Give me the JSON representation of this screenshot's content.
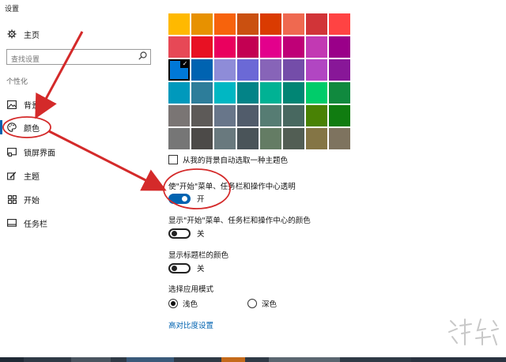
{
  "window": {
    "title": "设置"
  },
  "nav": {
    "home": {
      "label": "主页",
      "icon": "gear-icon"
    },
    "search": {
      "placeholder": "查找设置",
      "icon": "search-icon"
    },
    "section": "个性化",
    "items": [
      {
        "label": "背景",
        "icon": "image-icon"
      },
      {
        "label": "颜色",
        "icon": "palette-icon",
        "active": true
      },
      {
        "label": "锁屏界面",
        "icon": "lock-screen-icon"
      },
      {
        "label": "主题",
        "icon": "theme-icon"
      },
      {
        "label": "开始",
        "icon": "start-grid-icon"
      },
      {
        "label": "任务栏",
        "icon": "taskbar-icon"
      }
    ]
  },
  "colors": {
    "accent": "#0063b1",
    "swatches": [
      "#ffb900",
      "#e79100",
      "#f7630c",
      "#ca5010",
      "#da3b01",
      "#ef6950",
      "#d13438",
      "#ff4343",
      "#e74856",
      "#e81123",
      "#ea005e",
      "#c30052",
      "#e3008c",
      "#bf0077",
      "#c239b3",
      "#9a0089",
      "#0078d7",
      "#0063b1",
      "#8e8cd8",
      "#6b69d6",
      "#8764b8",
      "#744da9",
      "#b146c2",
      "#881798",
      "#0099bc",
      "#2d7d9a",
      "#00b7c3",
      "#038387",
      "#00b294",
      "#018574",
      "#00cc6a",
      "#10893e",
      "#7a7574",
      "#5d5a58",
      "#68768a",
      "#515c6b",
      "#567c73",
      "#486860",
      "#498205",
      "#107c10",
      "#767676",
      "#4c4a48",
      "#69797e",
      "#4a5459",
      "#647c64",
      "#525e54",
      "#847545",
      "#7e735f"
    ],
    "selected_index": 16,
    "check_glyph": "✓"
  },
  "auto_pick": {
    "label": "从我的背景自动选取一种主题色",
    "checked": false
  },
  "transparency": {
    "label": "使\"开始\"菜单、任务栏和操作中心透明",
    "state_label": "开",
    "on": true
  },
  "show_color_start": {
    "label": "显示\"开始\"菜单、任务栏和操作中心的颜色",
    "state_label": "关",
    "on": false
  },
  "show_color_title": {
    "label": "显示标题栏的颜色",
    "state_label": "关",
    "on": false
  },
  "app_mode": {
    "label": "选择应用模式",
    "options": [
      {
        "label": "浅色",
        "checked": true
      },
      {
        "label": "深色",
        "checked": false
      }
    ]
  },
  "high_contrast_link": "高对比度设置",
  "annotations": {
    "color": "#d42a2a"
  }
}
